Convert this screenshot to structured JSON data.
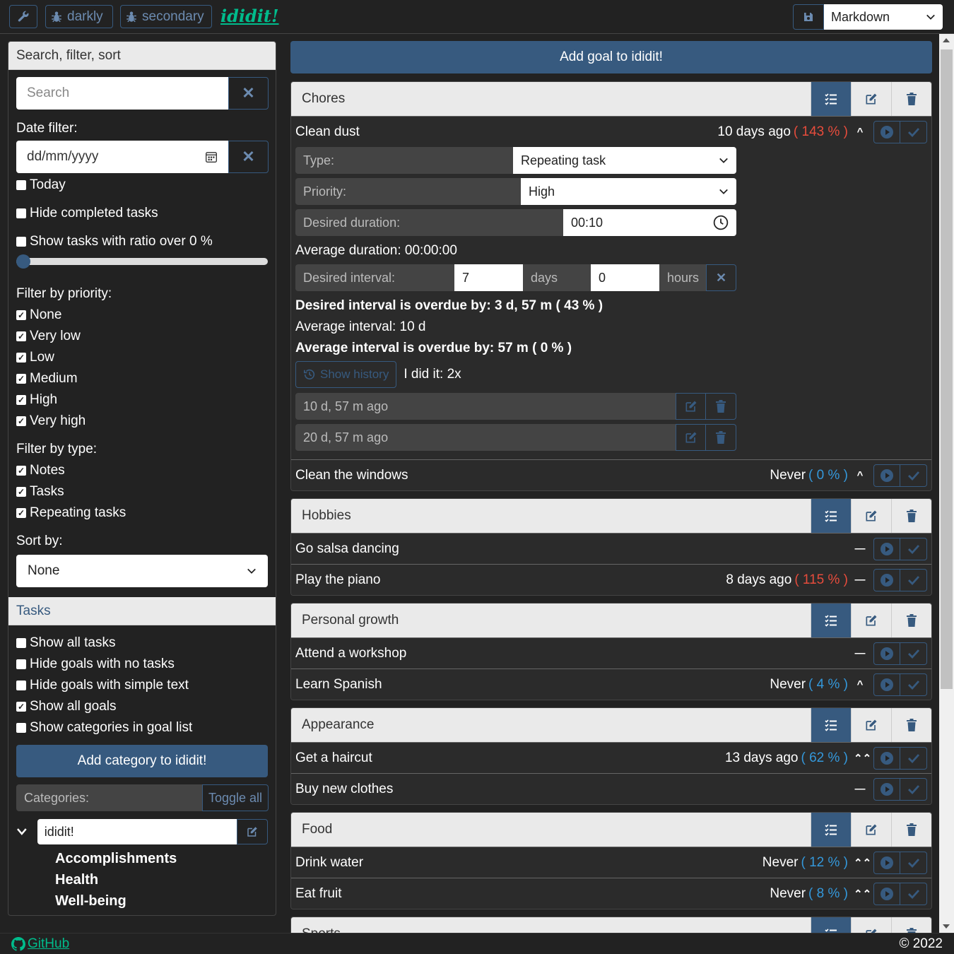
{
  "topbar": {
    "tools_icon": "wrench-icon",
    "theme1_label": "darkly",
    "theme2_label": "secondary",
    "brand": "ididit!",
    "export_format": "Markdown"
  },
  "sidebar": {
    "search_header": "Search, filter, sort",
    "search_placeholder": "Search",
    "date_filter_label": "Date filter:",
    "date_placeholder": "dd/mm/yyyy",
    "today_label": "Today",
    "hide_completed_label": "Hide completed tasks",
    "ratio_label": "Show tasks with ratio over 0 %",
    "ratio_value": 0,
    "priority_label": "Filter by priority:",
    "priorities": [
      {
        "label": "None",
        "checked": true
      },
      {
        "label": "Very low",
        "checked": true
      },
      {
        "label": "Low",
        "checked": true
      },
      {
        "label": "Medium",
        "checked": true
      },
      {
        "label": "High",
        "checked": true
      },
      {
        "label": "Very high",
        "checked": true
      }
    ],
    "type_label": "Filter by type:",
    "types": [
      {
        "label": "Notes",
        "checked": true
      },
      {
        "label": "Tasks",
        "checked": true
      },
      {
        "label": "Repeating tasks",
        "checked": true
      }
    ],
    "sort_label": "Sort by:",
    "sort_value": "None",
    "tasks_header": "Tasks",
    "task_options": [
      {
        "label": "Show all tasks",
        "checked": false
      },
      {
        "label": "Hide goals with no tasks",
        "checked": false
      },
      {
        "label": "Hide goals with simple text",
        "checked": false
      },
      {
        "label": "Show all goals",
        "checked": true
      },
      {
        "label": "Show categories in goal list",
        "checked": false
      }
    ],
    "add_category_label": "Add category to ididit!",
    "categories_label": "Categories:",
    "toggle_all_label": "Toggle all",
    "root_category": "ididit!",
    "subcategories": [
      "Accomplishments",
      "Health",
      "Well-being"
    ]
  },
  "main": {
    "add_goal_label": "Add goal to ididit!",
    "categories": [
      {
        "title": "Chores",
        "goals": [
          {
            "name": "Clean dust",
            "when": "10 days ago",
            "pct": "( 143 % )",
            "pct_color": "#e74c3c",
            "prio": "^"
          },
          {
            "name": "Clean the windows",
            "when": "Never",
            "pct": "( 0 % )",
            "pct_color": "#3498db",
            "prio": "^"
          }
        ]
      },
      {
        "title": "Hobbies",
        "goals": [
          {
            "name": "Go salsa dancing",
            "when": "",
            "pct": "",
            "pct_color": "#3498db",
            "prio": "—"
          },
          {
            "name": "Play the piano",
            "when": "8 days ago",
            "pct": "( 115 % )",
            "pct_color": "#e74c3c",
            "prio": "—"
          }
        ]
      },
      {
        "title": "Personal growth",
        "goals": [
          {
            "name": "Attend a workshop",
            "when": "",
            "pct": "",
            "pct_color": "#3498db",
            "prio": "—"
          },
          {
            "name": "Learn Spanish",
            "when": "Never",
            "pct": "( 4 % )",
            "pct_color": "#3498db",
            "prio": "^"
          }
        ]
      },
      {
        "title": "Appearance",
        "goals": [
          {
            "name": "Get a haircut",
            "when": "13 days ago",
            "pct": "( 62 % )",
            "pct_color": "#3498db",
            "prio": "⌃⌃"
          },
          {
            "name": "Buy new clothes",
            "when": "",
            "pct": "",
            "pct_color": "#3498db",
            "prio": "—"
          }
        ]
      },
      {
        "title": "Food",
        "goals": [
          {
            "name": "Drink water",
            "when": "Never",
            "pct": "( 12 % )",
            "pct_color": "#3498db",
            "prio": "⌃⌃"
          },
          {
            "name": "Eat fruit",
            "when": "Never",
            "pct": "( 8 % )",
            "pct_color": "#3498db",
            "prio": "⌃⌃"
          }
        ]
      },
      {
        "title": "Sports",
        "goals": []
      }
    ],
    "detail": {
      "type_label": "Type:",
      "type_value": "Repeating task",
      "priority_label": "Priority:",
      "priority_value": "High",
      "duration_label": "Desired duration:",
      "duration_value": "00:10",
      "avg_duration": "Average duration: 00:00:00",
      "interval_label": "Desired interval:",
      "interval_days": "7",
      "days_label": "days",
      "interval_hours": "0",
      "hours_label": "hours",
      "overdue": "Desired interval is overdue by: 3 d, 57 m ( 43 % )",
      "avg_interval": "Average interval: 10 d",
      "avg_overdue": "Average interval is overdue by: 57 m ( 0 % )",
      "show_history_label": "Show history",
      "did_it": "I did it: 2x",
      "history": [
        "10 d, 57 m ago",
        "20 d, 57 m ago"
      ]
    }
  },
  "footer": {
    "github_label": "GitHub",
    "copyright": "© 2022"
  },
  "colors": {
    "primary": "#375a7f",
    "success": "#00bc8c",
    "danger": "#e74c3c",
    "info": "#3498db",
    "bg": "#222222"
  }
}
